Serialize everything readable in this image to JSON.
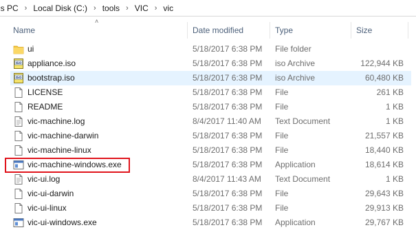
{
  "breadcrumb": [
    "is PC",
    "Local Disk (C:)",
    "tools",
    "VIC",
    "vic"
  ],
  "columns": {
    "name": "Name",
    "date": "Date modified",
    "type": "Type",
    "size": "Size"
  },
  "files": [
    {
      "name": "ui",
      "date": "5/18/2017 6:38 PM",
      "type": "File folder",
      "size": "",
      "icon": "folder-icon"
    },
    {
      "name": "appliance.iso",
      "date": "5/18/2017 6:38 PM",
      "type": "iso Archive",
      "size": "122,944 KB",
      "icon": "iso-icon"
    },
    {
      "name": "bootstrap.iso",
      "date": "5/18/2017 6:38 PM",
      "type": "iso Archive",
      "size": "60,480 KB",
      "icon": "iso-icon"
    },
    {
      "name": "LICENSE",
      "date": "5/18/2017 6:38 PM",
      "type": "File",
      "size": "261 KB",
      "icon": "file-icon"
    },
    {
      "name": "README",
      "date": "5/18/2017 6:38 PM",
      "type": "File",
      "size": "1 KB",
      "icon": "file-icon"
    },
    {
      "name": "vic-machine.log",
      "date": "8/4/2017 11:40 AM",
      "type": "Text Document",
      "size": "1 KB",
      "icon": "text-file-icon"
    },
    {
      "name": "vic-machine-darwin",
      "date": "5/18/2017 6:38 PM",
      "type": "File",
      "size": "21,557 KB",
      "icon": "file-icon"
    },
    {
      "name": "vic-machine-linux",
      "date": "5/18/2017 6:38 PM",
      "type": "File",
      "size": "18,440 KB",
      "icon": "file-icon"
    },
    {
      "name": "vic-machine-windows.exe",
      "date": "5/18/2017 6:38 PM",
      "type": "Application",
      "size": "18,614 KB",
      "icon": "exe-icon"
    },
    {
      "name": "vic-ui.log",
      "date": "8/4/2017 11:43 AM",
      "type": "Text Document",
      "size": "1 KB",
      "icon": "text-file-icon"
    },
    {
      "name": "vic-ui-darwin",
      "date": "5/18/2017 6:38 PM",
      "type": "File",
      "size": "29,643 KB",
      "icon": "file-icon"
    },
    {
      "name": "vic-ui-linux",
      "date": "5/18/2017 6:38 PM",
      "type": "File",
      "size": "29,913 KB",
      "icon": "file-icon"
    },
    {
      "name": "vic-ui-windows.exe",
      "date": "5/18/2017 6:38 PM",
      "type": "Application",
      "size": "29,767 KB",
      "icon": "exe-icon"
    }
  ],
  "selected_file": "bootstrap.iso",
  "highlighted_file": "vic-machine-windows.exe",
  "colors": {
    "highlight_border": "#e0131b",
    "selection": "#e5f3ff",
    "header_text": "#4c607a"
  }
}
